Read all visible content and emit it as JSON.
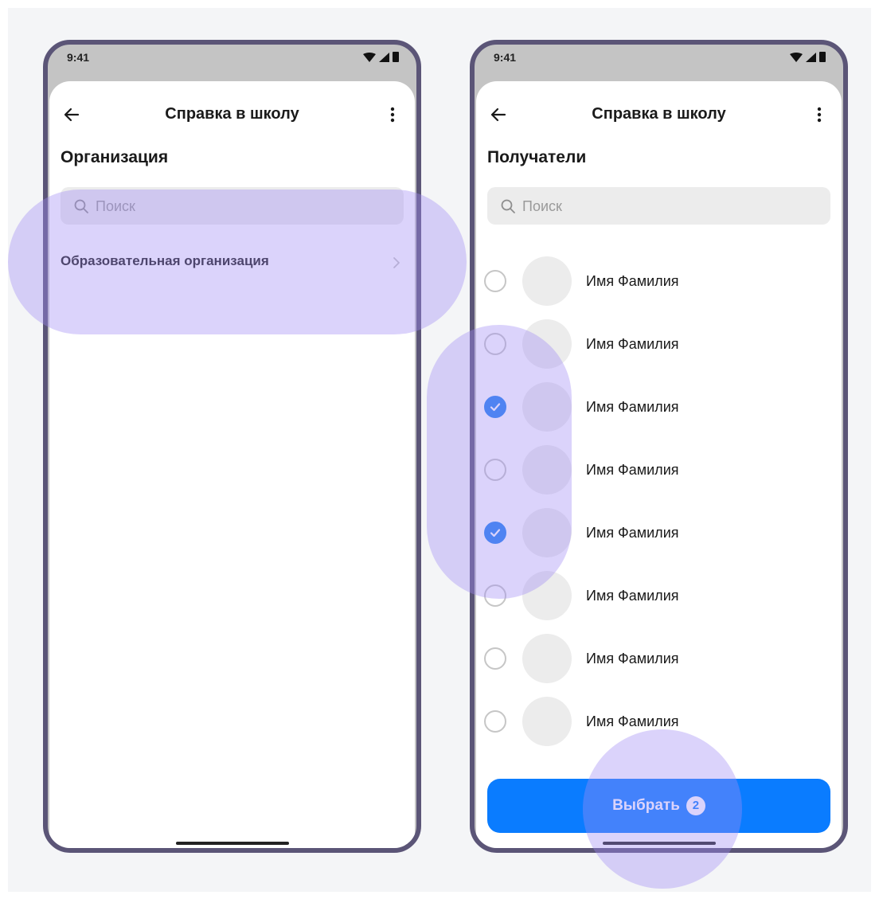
{
  "colors": {
    "frame": "#5b5577",
    "accent": "#0a7cff",
    "checked": "#1e7ff0",
    "highlight": "#a08cf5"
  },
  "phone_left": {
    "status": {
      "time": "9:41"
    },
    "appbar": {
      "title": "Справка в школу",
      "back_icon": "arrow-left-icon",
      "menu_icon": "more-vertical-icon"
    },
    "section_title": "Организация",
    "search": {
      "placeholder": "Поиск",
      "icon": "search-icon"
    },
    "organizations": [
      {
        "label": "Образовательная организация",
        "icon": "chevron-right-icon"
      }
    ]
  },
  "phone_right": {
    "status": {
      "time": "9:41"
    },
    "appbar": {
      "title": "Справка в школу",
      "back_icon": "arrow-left-icon",
      "menu_icon": "more-vertical-icon"
    },
    "section_title": "Получатели",
    "search": {
      "placeholder": "Поиск",
      "icon": "search-icon"
    },
    "recipients": [
      {
        "name": "Имя Фамилия",
        "checked": false
      },
      {
        "name": "Имя Фамилия",
        "checked": false
      },
      {
        "name": "Имя Фамилия",
        "checked": true
      },
      {
        "name": "Имя Фамилия",
        "checked": false
      },
      {
        "name": "Имя Фамилия",
        "checked": true
      },
      {
        "name": "Имя Фамилия",
        "checked": false
      },
      {
        "name": "Имя Фамилия",
        "checked": false
      },
      {
        "name": "Имя Фамилия",
        "checked": false
      }
    ],
    "select_button": {
      "label": "Выбрать",
      "count": "2"
    }
  }
}
